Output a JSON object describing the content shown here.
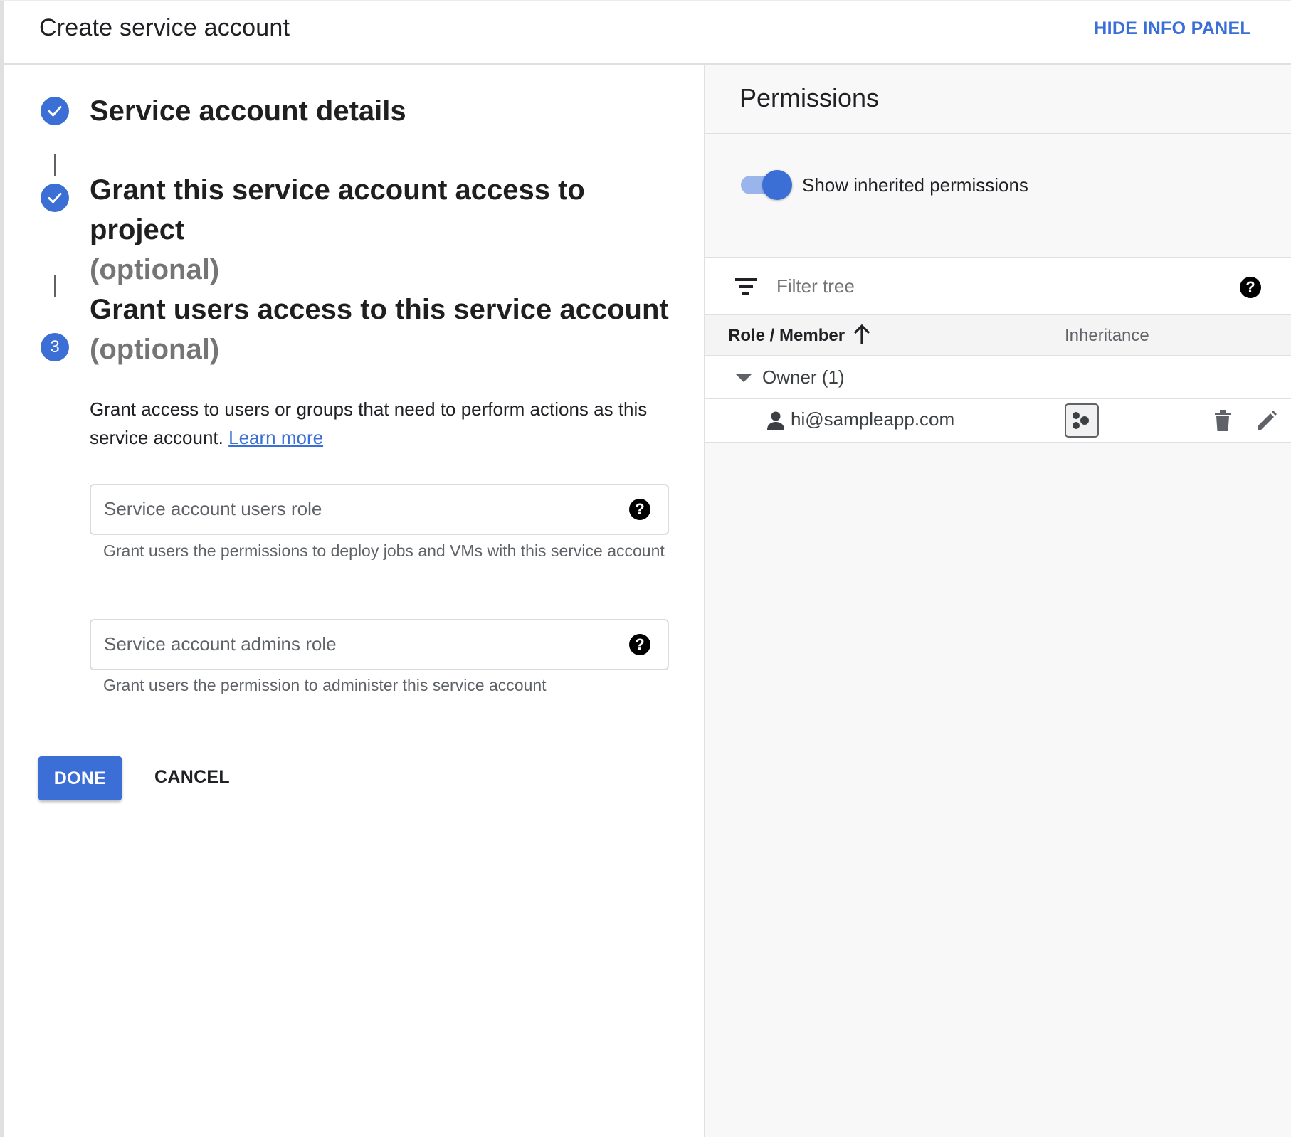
{
  "header": {
    "title": "Create service account",
    "hide_info_panel": "HIDE INFO PANEL"
  },
  "steps": [
    {
      "icon": "check-icon",
      "title": "Service account details",
      "optional": ""
    },
    {
      "icon": "check-icon",
      "title": "Grant this service account access to project",
      "optional": "(optional)"
    },
    {
      "icon": "step-number",
      "number": "3",
      "title": "Grant users access to this service account",
      "optional": "(optional)"
    }
  ],
  "step3": {
    "description": "Grant access to users or groups that need to perform actions as this service account.",
    "learn_more": "Learn more",
    "users_role": {
      "placeholder": "Service account users role",
      "hint": "Grant users the permissions to deploy jobs and VMs with this service account"
    },
    "admins_role": {
      "placeholder": "Service account admins role",
      "hint": "Grant users the permission to administer this service account"
    }
  },
  "actions": {
    "done": "DONE",
    "cancel": "CANCEL"
  },
  "info_panel": {
    "title": "Permissions",
    "toggle_label": "Show inherited permissions",
    "toggle_on": true,
    "filter_placeholder": "Filter tree",
    "columns": {
      "role_member": "Role / Member",
      "inheritance": "Inheritance"
    },
    "groups": [
      {
        "label": "Owner (1)",
        "members": [
          {
            "email": "hi@sampleapp.com",
            "icon": "person-icon"
          }
        ]
      }
    ]
  },
  "colors": {
    "accent": "#3c6fd6",
    "link": "#3b6fd8",
    "panel_bg": "#f8f8f8"
  }
}
